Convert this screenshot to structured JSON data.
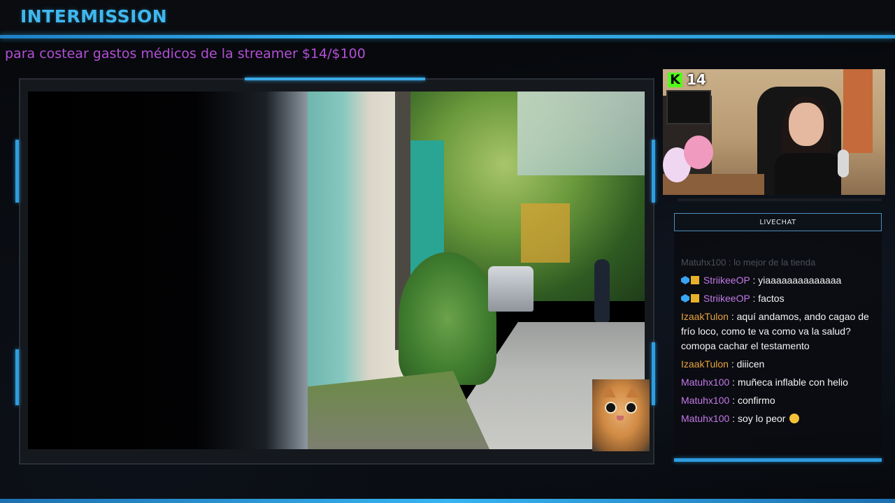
{
  "header": {
    "title": "INTERMISSION",
    "ticker": "para costear gastos médicos de la streamer $14/$100"
  },
  "webcam": {
    "kick_logo_letter": "K",
    "viewer_count": "14"
  },
  "chat": {
    "header_label": "LIVECHAT",
    "faded_top_line": "Matuhx100 : lo mejor de la tienda",
    "messages": [
      {
        "user": "StriikeeOP",
        "text": " : yiaaaaaaaaaaaaaa",
        "badges": [
          "bits-icon",
          "crown-icon"
        ],
        "color": "#c478e8"
      },
      {
        "user": "StriikeeOP",
        "text": " : factos",
        "badges": [
          "bits-icon",
          "crown-icon"
        ],
        "color": "#c478e8"
      },
      {
        "user": "IzaakTulon",
        "text": " : aquí andamos, ando cagao de frío loco, como te va como va la salud? comopa cachar el testamento",
        "badges": [],
        "color": "#e8a33c"
      },
      {
        "user": "IzaakTulon",
        "text": " : diiicen",
        "badges": [],
        "color": "#e8a33c"
      },
      {
        "user": "Matuhx100",
        "text": " : muñeca inflable con helio",
        "badges": [],
        "color": "#c478e8"
      },
      {
        "user": "Matuhx100",
        "text": " : confirmo",
        "badges": [],
        "color": "#c478e8"
      },
      {
        "user": "Matuhx100",
        "text": " : soy lo peor ",
        "badges": [],
        "emoji": "rolling-laughing-emoji",
        "color": "#c478e8"
      }
    ]
  },
  "colors": {
    "accent_blue": "#36b4f0",
    "ticker_purple": "#b44fd6",
    "kick_green": "#53fc18",
    "background": "#07090d"
  }
}
